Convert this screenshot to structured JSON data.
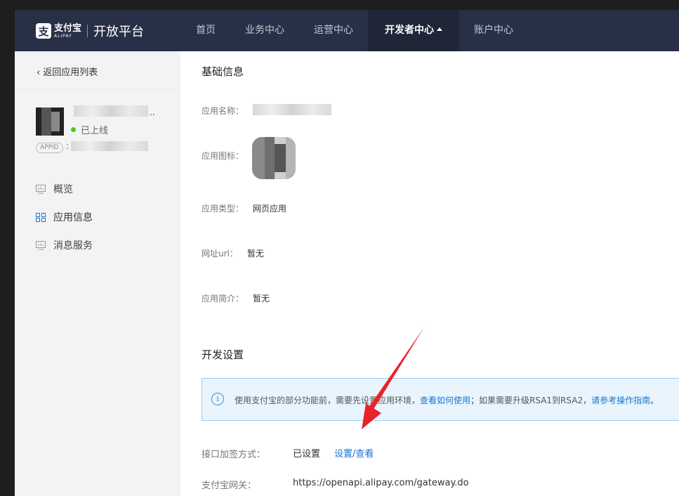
{
  "header": {
    "logo_mark": "支",
    "logo_cn": "支付宝",
    "logo_en": "ALIPAY",
    "platform": "开放平台",
    "nav": [
      {
        "label": "首页"
      },
      {
        "label": "业务中心"
      },
      {
        "label": "运营中心"
      },
      {
        "label": "开发者中心",
        "active": true
      },
      {
        "label": "账户中心"
      }
    ]
  },
  "sidebar": {
    "back_label": "返回应用列表",
    "app_name_suffix": "..",
    "status_label": "已上线",
    "appid_tag": "APPID",
    "appid_prefix": ":",
    "menu": [
      {
        "label": "概览",
        "icon": "chart-icon"
      },
      {
        "label": "应用信息",
        "icon": "grid-icon",
        "active": true
      },
      {
        "label": "消息服务",
        "icon": "chart-icon"
      }
    ]
  },
  "basic_info": {
    "title": "基础信息",
    "app_name_label": "应用名称：",
    "app_icon_label": "应用图标：",
    "app_type_label": "应用类型：",
    "app_type_value": "网页应用",
    "url_label": "网址url：",
    "url_value": "暂无",
    "desc_label": "应用简介：",
    "desc_value": "暂无"
  },
  "dev_settings": {
    "title": "开发设置",
    "notice": {
      "icon": "info-icon",
      "text_1": "使用支付宝的部分功能前，需要先设置应用环境，",
      "link_1": "查看如何使用",
      "text_2": "；如果需要升级RSA1到RSA2，",
      "link_2": "请参考操作指南",
      "text_3": "。"
    },
    "sign_label": "接口加签方式：",
    "sign_value": "已设置",
    "sign_link": "设置/查看",
    "gateway_label": "支付宝网关：",
    "gateway_value": "https://openapi.alipay.com/gateway.do"
  },
  "colors": {
    "topbar": "#283047",
    "link": "#1677d2",
    "status_online": "#52c41a",
    "annotation_arrow": "#e8232d"
  }
}
